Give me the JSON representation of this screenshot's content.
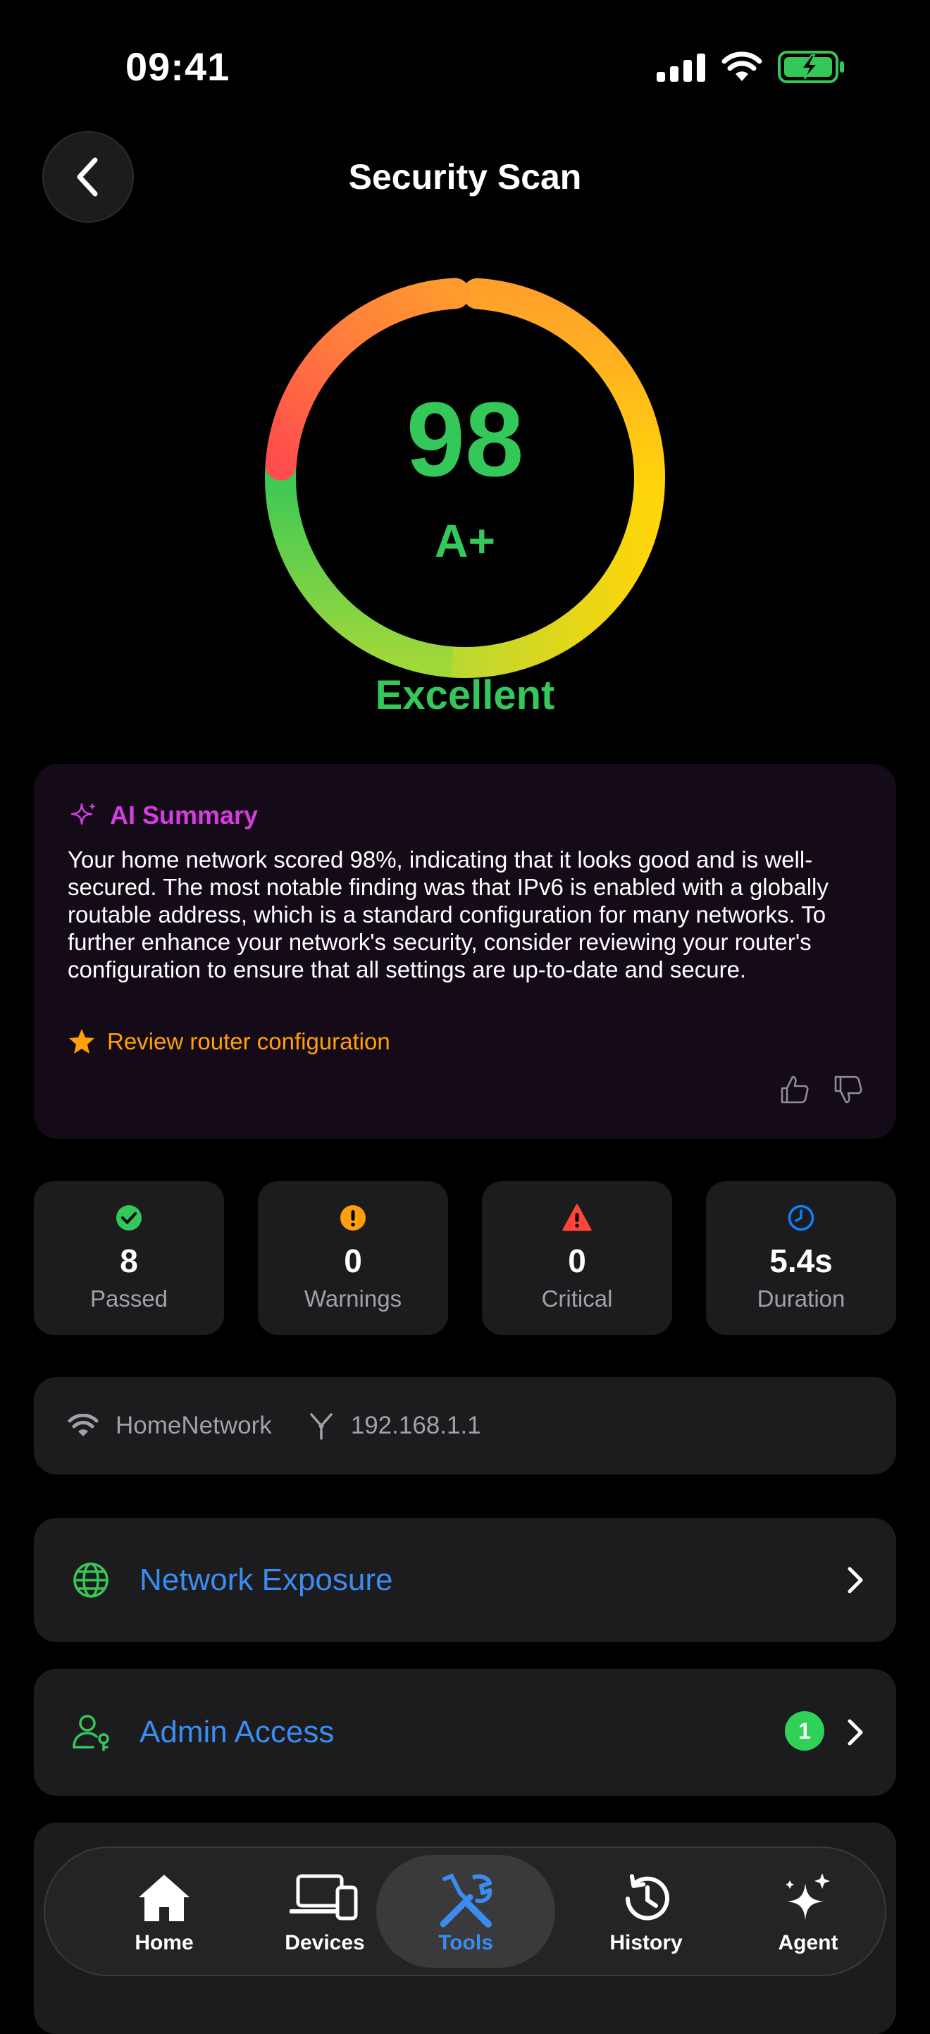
{
  "status_bar": {
    "time": "09:41"
  },
  "header": {
    "title": "Security Scan"
  },
  "score": {
    "value": "98",
    "grade": "A+",
    "label": "Excellent",
    "fraction": 0.98
  },
  "ai_summary": {
    "title": "AI Summary",
    "text": "Your home network scored 98%, indicating that it looks good and is well-secured. The most notable finding was that IPv6 is enabled with a globally routable address, which is a standard configuration for many networks. To further enhance your network's security, consider reviewing your router's configuration to ensure that all settings are up-to-date and secure.",
    "recommendation": "Review router configuration"
  },
  "stats": [
    {
      "value": "8",
      "label": "Passed",
      "icon": "check-circle-icon",
      "color": "#34c759"
    },
    {
      "value": "0",
      "label": "Warnings",
      "icon": "exclamation-circle-icon",
      "color": "#ff9f0a"
    },
    {
      "value": "0",
      "label": "Critical",
      "icon": "warning-triangle-icon",
      "color": "#ff453a"
    },
    {
      "value": "5.4s",
      "label": "Duration",
      "icon": "clock-icon",
      "color": "#0a84ff"
    }
  ],
  "network": {
    "ssid": "HomeNetwork",
    "gateway": "192.168.1.1"
  },
  "sections": [
    {
      "label": "Network Exposure",
      "icon": "globe-icon"
    },
    {
      "label": "Admin Access",
      "icon": "admin-user-icon",
      "badge": "1"
    }
  ],
  "tabs": [
    {
      "label": "Home",
      "icon": "house-icon"
    },
    {
      "label": "Devices",
      "icon": "devices-icon"
    },
    {
      "label": "Tools",
      "icon": "tools-icon",
      "active": true
    },
    {
      "label": "History",
      "icon": "history-icon"
    },
    {
      "label": "Agent",
      "icon": "sparkles-icon"
    }
  ],
  "colors": {
    "accent": "#3a8cf0",
    "success": "#34c759",
    "ai": "#d23ee0",
    "warning": "#ff9f0a"
  }
}
